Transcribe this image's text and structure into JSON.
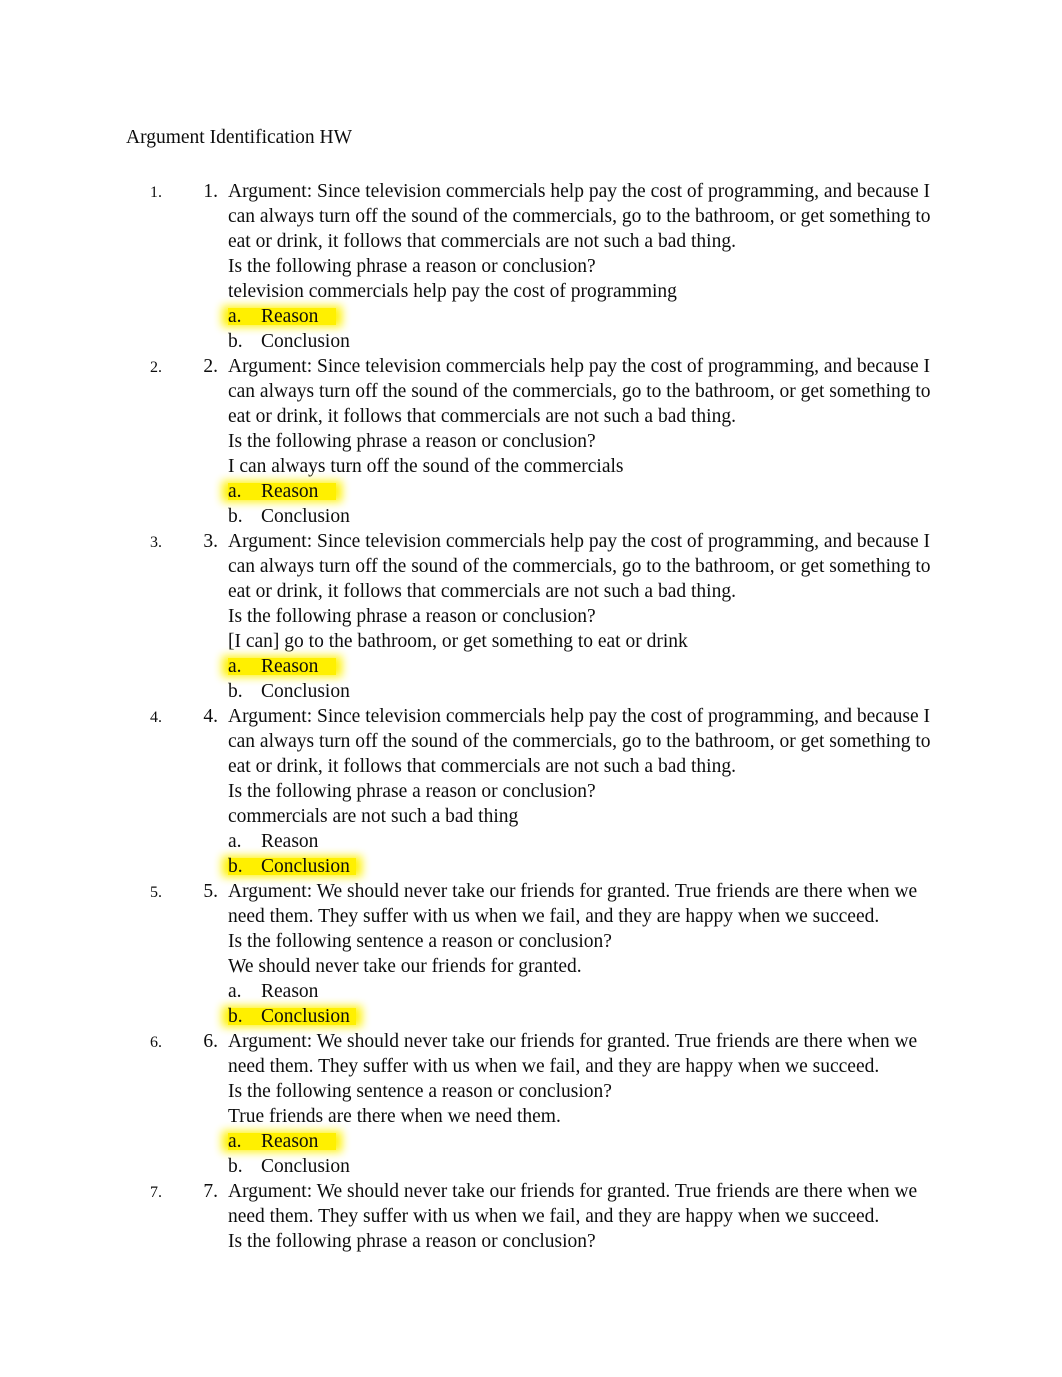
{
  "document": {
    "title": "Argument Identification HW",
    "background_color": "#ffffff",
    "text_color": "#0d0d0d",
    "highlight_color": "#fff000"
  },
  "questions": [
    {
      "number": "1.",
      "argument": "Argument: Since television commercials help pay the cost of programming, and because I can always turn off the sound of the commercials, go to the bathroom, or get something to eat or drink, it follows that commercials are not such a bad thing.",
      "prompt": "Is the following phrase a reason or conclusion?",
      "phrase": "television commercials help pay the cost of programming",
      "options": [
        {
          "marker": "a.",
          "label": "Reason",
          "highlighted": true
        },
        {
          "marker": "b.",
          "label": "Conclusion",
          "highlighted": false
        }
      ]
    },
    {
      "number": "2.",
      "argument": "Argument: Since television commercials help pay the cost of programming, and because I can always turn off the sound of the commercials, go to the bathroom, or get something to eat or drink, it follows that commercials are not such a bad thing.",
      "prompt": "Is the following phrase a reason or conclusion?",
      "phrase": "I can always turn off the sound of the commercials",
      "options": [
        {
          "marker": "a.",
          "label": "Reason",
          "highlighted": true
        },
        {
          "marker": "b.",
          "label": "Conclusion",
          "highlighted": false
        }
      ]
    },
    {
      "number": "3.",
      "argument": "Argument: Since television commercials help pay the cost of programming, and because I can always turn off the sound of the commercials, go to the bathroom, or get something to eat or drink, it follows that commercials are not such a bad thing.",
      "prompt": "Is the following phrase a reason or conclusion?",
      "phrase": "[I can] go to the bathroom, or get something to eat or drink",
      "options": [
        {
          "marker": "a.",
          "label": "Reason",
          "highlighted": true
        },
        {
          "marker": "b.",
          "label": "Conclusion",
          "highlighted": false
        }
      ]
    },
    {
      "number": "4.",
      "argument": "Argument: Since television commercials help pay the cost of programming, and because I can always turn off the sound of the commercials, go to the bathroom, or get something to eat or drink, it follows that commercials are not such a bad thing.",
      "prompt": "Is the following phrase a reason or conclusion?",
      "phrase": "commercials are not such a bad thing",
      "options": [
        {
          "marker": "a.",
          "label": "Reason",
          "highlighted": false
        },
        {
          "marker": "b.",
          "label": "Conclusion",
          "highlighted": true
        }
      ]
    },
    {
      "number": "5.",
      "argument": "Argument: We should never take our friends for granted. True friends are there when we need them. They suffer with us when we fail, and they are happy when we succeed.",
      "prompt": "Is the following sentence a reason or conclusion?",
      "phrase": "We should never take our friends for granted.",
      "options": [
        {
          "marker": "a.",
          "label": "Reason",
          "highlighted": false
        },
        {
          "marker": "b.",
          "label": "Conclusion",
          "highlighted": true
        }
      ]
    },
    {
      "number": "6.",
      "argument": "Argument: We should never take our friends for granted. True friends are there when we need them. They suffer with us when we fail, and they are happy when we succeed.",
      "prompt": "Is the following sentence a reason or conclusion?",
      "phrase": "True friends are there when we need them.",
      "options": [
        {
          "marker": "a.",
          "label": "Reason",
          "highlighted": true
        },
        {
          "marker": "b.",
          "label": "Conclusion",
          "highlighted": false
        }
      ]
    },
    {
      "number": "7.",
      "argument": "Argument: We should never take our friends for granted. True friends are there when we need them. They suffer with us when we fail, and they are happy when we succeed.",
      "prompt": "Is the following phrase a reason or conclusion?",
      "phrase": "",
      "options": []
    }
  ]
}
